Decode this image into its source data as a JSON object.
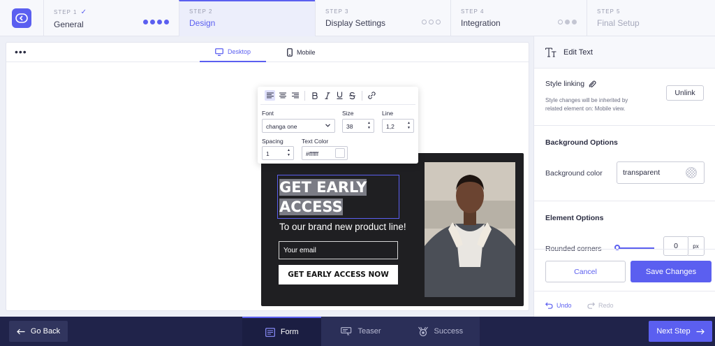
{
  "steps": [
    {
      "num": "STEP 1",
      "check": "✓",
      "name": "General"
    },
    {
      "num": "STEP 2",
      "name": "Design"
    },
    {
      "num": "STEP 3",
      "name": "Display Settings"
    },
    {
      "num": "STEP 4",
      "name": "Integration"
    },
    {
      "num": "STEP 5",
      "name": "Final Setup"
    }
  ],
  "canvas": {
    "more_icon": "•••",
    "device_tabs": [
      {
        "label": "Desktop",
        "icon": "desktop-icon"
      },
      {
        "label": "Mobile",
        "icon": "mobile-icon"
      }
    ]
  },
  "toolbar": {
    "font_label": "Font",
    "font_value": "changa one",
    "size_label": "Size",
    "size_value": "38",
    "line_label": "Line",
    "line_value": "1,2",
    "spacing_label": "Spacing",
    "spacing_value": "1",
    "color_label": "Text Color",
    "color_value": "#ffffff"
  },
  "popup": {
    "close": "×",
    "headline_line1": "GET EARLY",
    "headline_line2": "ACCESS",
    "subline": "To our brand new product line!",
    "email_placeholder": "Your email",
    "cta": "GET EARLY ACCESS NOW"
  },
  "panel": {
    "title": "Edit Text",
    "style_linking": {
      "title": "Style linking",
      "note_line1": "Style changes will be inherited by",
      "note_line2": "related element on: Mobile view.",
      "unlink": "Unlink"
    },
    "background": {
      "title": "Background Options",
      "label": "Background color",
      "value": "transparent"
    },
    "element": {
      "title": "Element Options",
      "label": "Rounded corners",
      "value": "0",
      "unit": "px"
    },
    "cancel": "Cancel",
    "save": "Save Changes",
    "undo": "Undo",
    "redo": "Redo"
  },
  "bottom": {
    "back": "Go Back",
    "tabs": [
      {
        "label": "Form",
        "icon": "form-icon"
      },
      {
        "label": "Teaser",
        "icon": "teaser-icon"
      },
      {
        "label": "Success",
        "icon": "success-icon"
      }
    ],
    "next": "Next Step"
  },
  "colors": {
    "accent": "#5b5ff0",
    "navy": "#20234a",
    "popup_bg": "#1f1f22"
  }
}
